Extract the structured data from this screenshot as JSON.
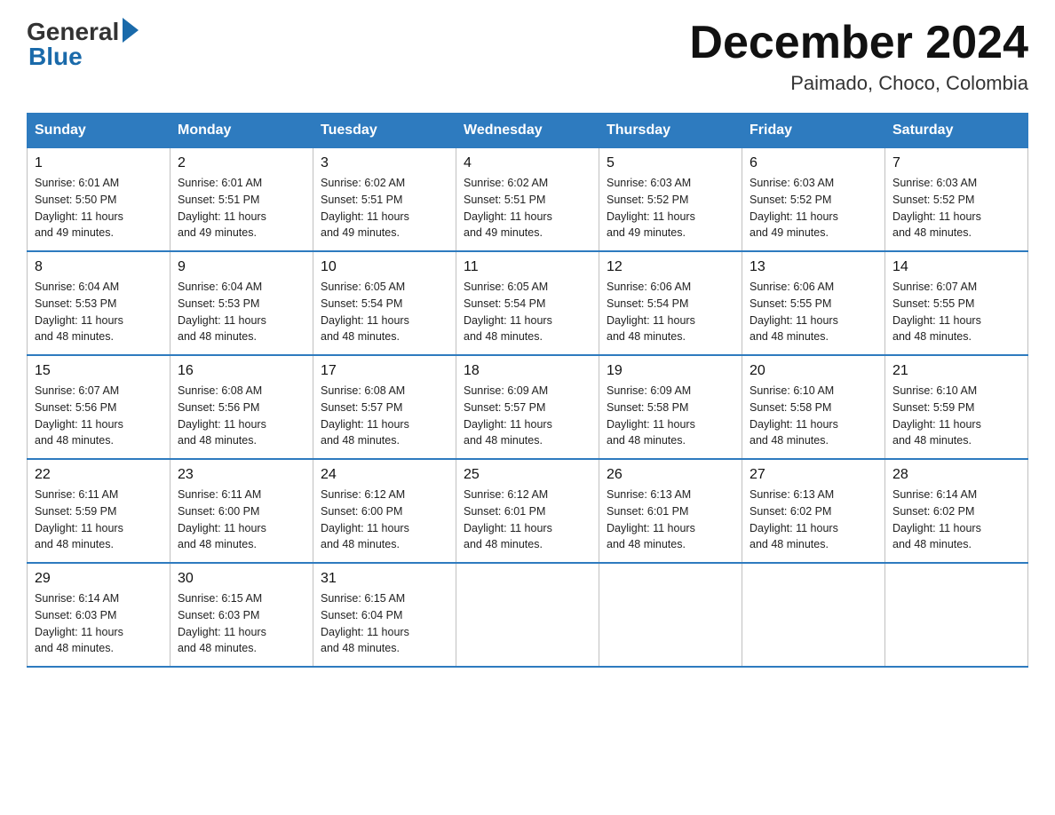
{
  "header": {
    "logo_general": "General",
    "logo_blue": "Blue",
    "month_title": "December 2024",
    "location": "Paimado, Choco, Colombia"
  },
  "days_of_week": [
    "Sunday",
    "Monday",
    "Tuesday",
    "Wednesday",
    "Thursday",
    "Friday",
    "Saturday"
  ],
  "weeks": [
    [
      {
        "day": "1",
        "sunrise": "6:01 AM",
        "sunset": "5:50 PM",
        "daylight": "11 hours and 49 minutes."
      },
      {
        "day": "2",
        "sunrise": "6:01 AM",
        "sunset": "5:51 PM",
        "daylight": "11 hours and 49 minutes."
      },
      {
        "day": "3",
        "sunrise": "6:02 AM",
        "sunset": "5:51 PM",
        "daylight": "11 hours and 49 minutes."
      },
      {
        "day": "4",
        "sunrise": "6:02 AM",
        "sunset": "5:51 PM",
        "daylight": "11 hours and 49 minutes."
      },
      {
        "day": "5",
        "sunrise": "6:03 AM",
        "sunset": "5:52 PM",
        "daylight": "11 hours and 49 minutes."
      },
      {
        "day": "6",
        "sunrise": "6:03 AM",
        "sunset": "5:52 PM",
        "daylight": "11 hours and 49 minutes."
      },
      {
        "day": "7",
        "sunrise": "6:03 AM",
        "sunset": "5:52 PM",
        "daylight": "11 hours and 48 minutes."
      }
    ],
    [
      {
        "day": "8",
        "sunrise": "6:04 AM",
        "sunset": "5:53 PM",
        "daylight": "11 hours and 48 minutes."
      },
      {
        "day": "9",
        "sunrise": "6:04 AM",
        "sunset": "5:53 PM",
        "daylight": "11 hours and 48 minutes."
      },
      {
        "day": "10",
        "sunrise": "6:05 AM",
        "sunset": "5:54 PM",
        "daylight": "11 hours and 48 minutes."
      },
      {
        "day": "11",
        "sunrise": "6:05 AM",
        "sunset": "5:54 PM",
        "daylight": "11 hours and 48 minutes."
      },
      {
        "day": "12",
        "sunrise": "6:06 AM",
        "sunset": "5:54 PM",
        "daylight": "11 hours and 48 minutes."
      },
      {
        "day": "13",
        "sunrise": "6:06 AM",
        "sunset": "5:55 PM",
        "daylight": "11 hours and 48 minutes."
      },
      {
        "day": "14",
        "sunrise": "6:07 AM",
        "sunset": "5:55 PM",
        "daylight": "11 hours and 48 minutes."
      }
    ],
    [
      {
        "day": "15",
        "sunrise": "6:07 AM",
        "sunset": "5:56 PM",
        "daylight": "11 hours and 48 minutes."
      },
      {
        "day": "16",
        "sunrise": "6:08 AM",
        "sunset": "5:56 PM",
        "daylight": "11 hours and 48 minutes."
      },
      {
        "day": "17",
        "sunrise": "6:08 AM",
        "sunset": "5:57 PM",
        "daylight": "11 hours and 48 minutes."
      },
      {
        "day": "18",
        "sunrise": "6:09 AM",
        "sunset": "5:57 PM",
        "daylight": "11 hours and 48 minutes."
      },
      {
        "day": "19",
        "sunrise": "6:09 AM",
        "sunset": "5:58 PM",
        "daylight": "11 hours and 48 minutes."
      },
      {
        "day": "20",
        "sunrise": "6:10 AM",
        "sunset": "5:58 PM",
        "daylight": "11 hours and 48 minutes."
      },
      {
        "day": "21",
        "sunrise": "6:10 AM",
        "sunset": "5:59 PM",
        "daylight": "11 hours and 48 minutes."
      }
    ],
    [
      {
        "day": "22",
        "sunrise": "6:11 AM",
        "sunset": "5:59 PM",
        "daylight": "11 hours and 48 minutes."
      },
      {
        "day": "23",
        "sunrise": "6:11 AM",
        "sunset": "6:00 PM",
        "daylight": "11 hours and 48 minutes."
      },
      {
        "day": "24",
        "sunrise": "6:12 AM",
        "sunset": "6:00 PM",
        "daylight": "11 hours and 48 minutes."
      },
      {
        "day": "25",
        "sunrise": "6:12 AM",
        "sunset": "6:01 PM",
        "daylight": "11 hours and 48 minutes."
      },
      {
        "day": "26",
        "sunrise": "6:13 AM",
        "sunset": "6:01 PM",
        "daylight": "11 hours and 48 minutes."
      },
      {
        "day": "27",
        "sunrise": "6:13 AM",
        "sunset": "6:02 PM",
        "daylight": "11 hours and 48 minutes."
      },
      {
        "day": "28",
        "sunrise": "6:14 AM",
        "sunset": "6:02 PM",
        "daylight": "11 hours and 48 minutes."
      }
    ],
    [
      {
        "day": "29",
        "sunrise": "6:14 AM",
        "sunset": "6:03 PM",
        "daylight": "11 hours and 48 minutes."
      },
      {
        "day": "30",
        "sunrise": "6:15 AM",
        "sunset": "6:03 PM",
        "daylight": "11 hours and 48 minutes."
      },
      {
        "day": "31",
        "sunrise": "6:15 AM",
        "sunset": "6:04 PM",
        "daylight": "11 hours and 48 minutes."
      },
      null,
      null,
      null,
      null
    ]
  ],
  "labels": {
    "sunrise": "Sunrise:",
    "sunset": "Sunset:",
    "daylight": "Daylight:"
  }
}
